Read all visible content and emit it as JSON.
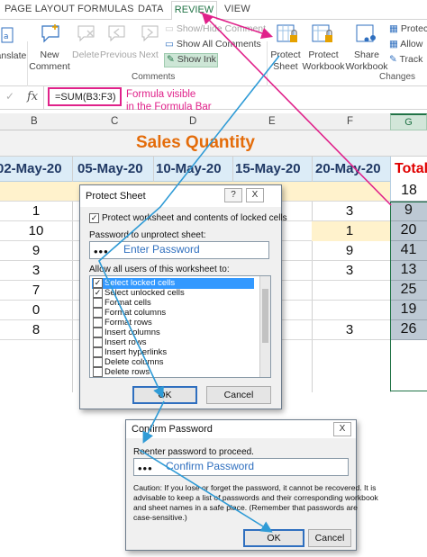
{
  "ribbon": {
    "tabs": [
      "PAGE LAYOUT",
      "FORMULAS",
      "DATA",
      "REVIEW",
      "VIEW"
    ],
    "left_edge_label": "Translate",
    "new_comment": "New Comment",
    "delete": "Delete",
    "previous": "Previous",
    "next": "Next",
    "show_hide_comment": "Show/Hide Comment",
    "show_all_comments": "Show All Comments",
    "show_ink": "Show Ink",
    "comments_group": "Comments",
    "protect_sheet": "Protect Sheet",
    "protect_workbook": "Protect Workbook",
    "share_workbook": "Share Workbook",
    "protect_shared": "Protect",
    "allow_users": "Allow",
    "track_changes": "Track",
    "changes_group": "Changes"
  },
  "formula_bar": {
    "fx": "fx",
    "formula": "=SUM(B3:F3)",
    "note_line1": "Formula visible",
    "note_line2": "in the Formula Bar"
  },
  "sheet": {
    "columns": [
      "B",
      "C",
      "D",
      "E",
      "F",
      "G"
    ],
    "title": "Sales Quantity",
    "dates": [
      "02-May-20",
      "05-May-20",
      "10-May-20",
      "15-May-20",
      "20-May-20"
    ],
    "total_header": "Total",
    "rows": [
      {
        "b": "",
        "f": "",
        "total": "18"
      },
      {
        "b": "1",
        "f": "3",
        "total": "9"
      },
      {
        "b": "10",
        "f": "1",
        "total": "20"
      },
      {
        "b": "9",
        "f": "9",
        "total": "41"
      },
      {
        "b": "3",
        "f": "3",
        "total": "13"
      },
      {
        "b": "7",
        "f": "",
        "total": "25"
      },
      {
        "b": "0",
        "f": "",
        "total": "19"
      },
      {
        "b": "8",
        "f": "3",
        "total": "26"
      }
    ]
  },
  "protect_dialog": {
    "title": "Protect Sheet",
    "help": "?",
    "close": "X",
    "protect_check_label": "Protect worksheet and contents of locked cells",
    "password_label": "Password to unprotect sheet:",
    "password_mask": "•••",
    "password_hint": "Enter Password",
    "allow_label": "Allow all users of this worksheet to:",
    "permissions": [
      {
        "label": "Select locked cells",
        "checked": true
      },
      {
        "label": "Select unlocked cells",
        "checked": true
      },
      {
        "label": "Format cells",
        "checked": false
      },
      {
        "label": "Format columns",
        "checked": false
      },
      {
        "label": "Format rows",
        "checked": false
      },
      {
        "label": "Insert columns",
        "checked": false
      },
      {
        "label": "Insert rows",
        "checked": false
      },
      {
        "label": "Insert hyperlinks",
        "checked": false
      },
      {
        "label": "Delete columns",
        "checked": false
      },
      {
        "label": "Delete rows",
        "checked": false
      }
    ],
    "ok": "OK",
    "cancel": "Cancel"
  },
  "confirm_dialog": {
    "title": "Confirm Password",
    "close": "X",
    "reenter_label": "Reenter password to proceed.",
    "password_mask": "•••",
    "password_hint": "Confirm Password",
    "caution_1": "Caution: If you lose or forget the password, it cannot be recovered. It is",
    "caution_2": "advisable to keep a list of passwords and their corresponding workbook",
    "caution_3": "and sheet names in a safe place.  (Remember that passwords are",
    "caution_4": "case-sensitive.)",
    "ok": "OK",
    "cancel": "Cancel"
  },
  "colors": {
    "excel_green": "#217346",
    "annotation_pink": "#e0218a",
    "annotation_blue": "#2f9bd6",
    "title_orange": "#e46c0a",
    "total_red": "#e00000",
    "total_fill": "#bdc9d4"
  }
}
